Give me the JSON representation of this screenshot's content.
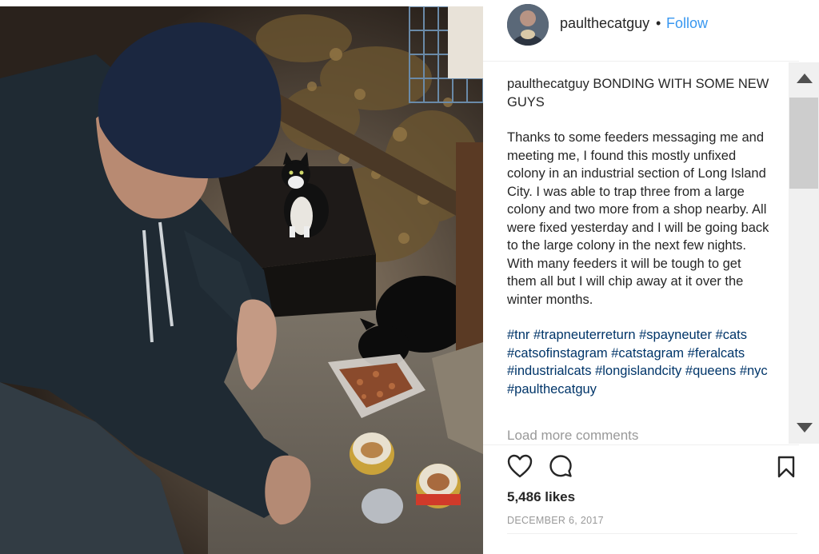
{
  "post": {
    "username": "paulthecatguy",
    "separator": "•",
    "follow_label": "Follow",
    "caption_user": "paulthecatguy",
    "caption_title": "BONDING WITH SOME NEW GUYS",
    "caption_body": "Thanks to some feeders messaging me and meeting me, I found this mostly unfixed colony in an industrial section of Long Island City. I was able to trap three from a large colony and two more from a shop nearby. All were fixed yesterday and I will be going back to the large colony in the next few nights. With many feeders it will be tough to get them all but I will chip away at it over the winter months.",
    "hashtags": [
      "#tnr",
      "#trapneuterreturn",
      "#spayneuter",
      "#cats",
      "#catsofinstagram",
      "#catstagram",
      "#feralcats",
      "#industrialcats",
      "#longislandcity",
      "#queens",
      "#nyc",
      "#paulthecatguy"
    ],
    "load_more": "Load more comments",
    "likes": "5,486 likes",
    "date": "DECEMBER 6, 2017"
  },
  "icons": {
    "like": "heart-icon",
    "comment": "comment-icon",
    "save": "bookmark-icon",
    "scroll_up": "scroll-up-arrow-icon",
    "scroll_down": "scroll-down-arrow-icon"
  },
  "colors": {
    "link": "#3897f0",
    "hashtag": "#003569",
    "muted": "#999999",
    "text": "#262626"
  }
}
